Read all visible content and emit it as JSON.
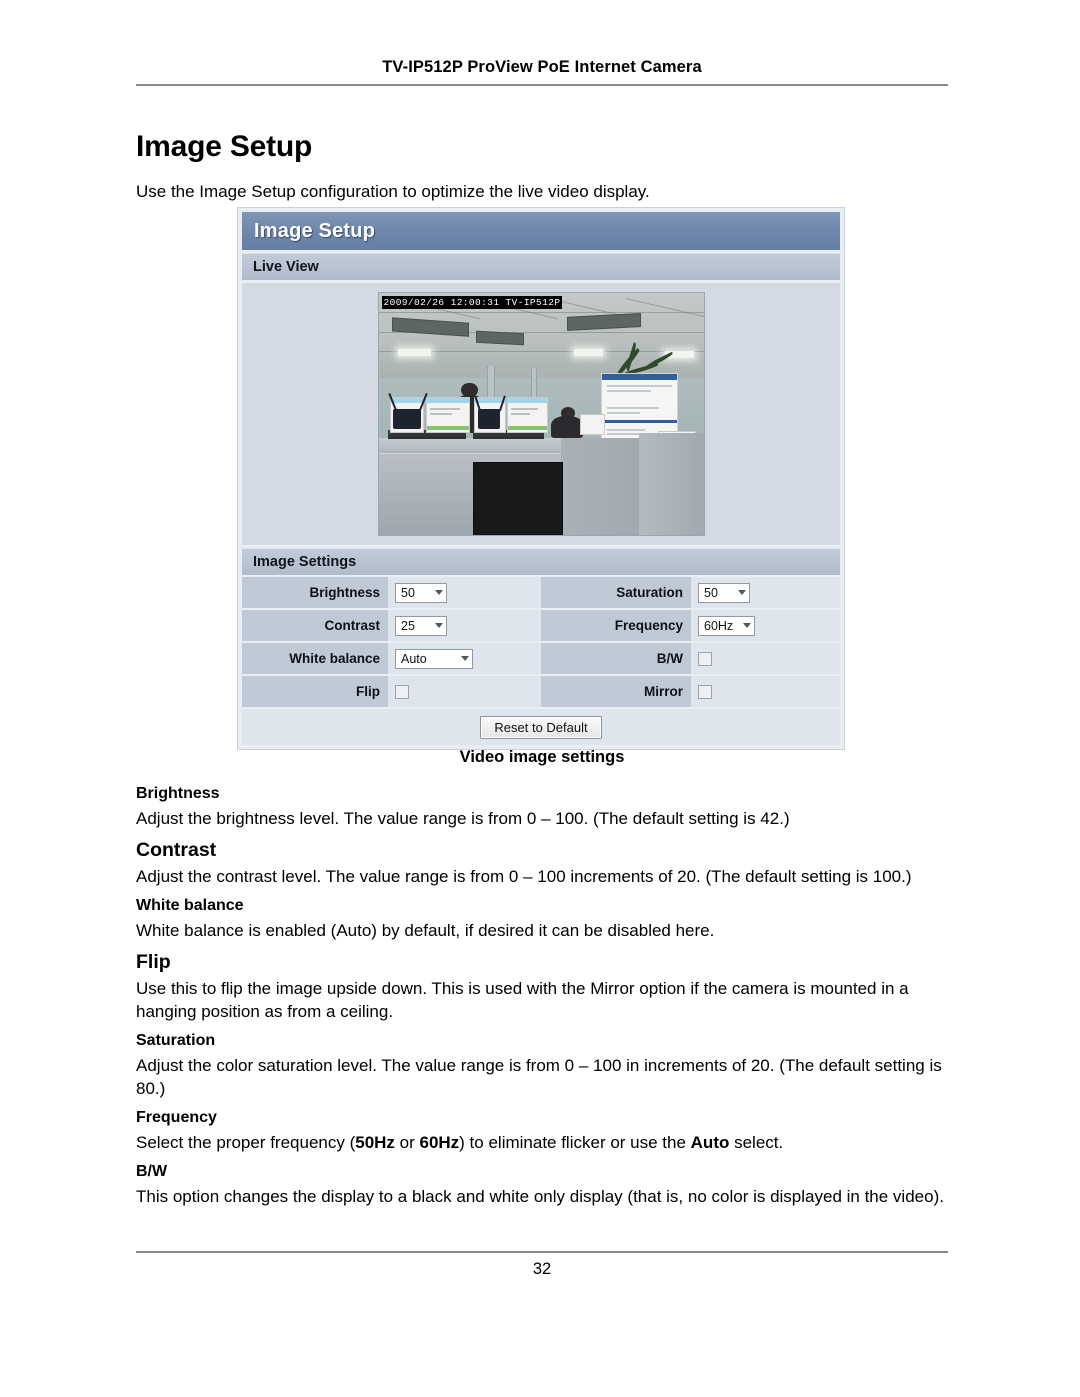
{
  "document": {
    "running_header": "TV-IP512P ProView PoE Internet Camera",
    "title": "Image Setup",
    "intro": "Use the Image Setup configuration to optimize the live video display.",
    "page_number": "32"
  },
  "ui_panel": {
    "titlebar": "Image Setup",
    "live_view_label": "Live View",
    "video": {
      "osd_text": "2009/02/26 12:00:31 TV-IP512P"
    },
    "image_settings_label": "Image Settings",
    "settings_left": [
      {
        "label": "Brightness",
        "control": "select",
        "value": "50"
      },
      {
        "label": "Contrast",
        "control": "select",
        "value": "25"
      },
      {
        "label": "White balance",
        "control": "select",
        "value": "Auto"
      },
      {
        "label": "Flip",
        "control": "checkbox",
        "value": "",
        "checked": false
      }
    ],
    "settings_right": [
      {
        "label": "Saturation",
        "control": "select",
        "value": "50"
      },
      {
        "label": "Frequency",
        "control": "select",
        "value": "60Hz"
      },
      {
        "label": "B/W",
        "control": "checkbox",
        "value": "",
        "checked": false
      },
      {
        "label": "Mirror",
        "control": "checkbox",
        "value": "",
        "checked": false
      }
    ],
    "reset_button": "Reset to Default",
    "colors": {
      "titlebar": "#6d86aa",
      "subbar": "#b0bbcb",
      "label_cell": "#c0c9d6",
      "value_cell": "#dfe5ed",
      "panel_bg": "#e9eef5"
    }
  },
  "body": {
    "caption": "Video image settings",
    "sections": [
      {
        "heading": "Brightness",
        "heading_size": "normal",
        "paragraphs": [
          {
            "parts": [
              {
                "text": "Adjust the brightness level. The value range is from 0 – 100. (The default setting is 42.)",
                "bold": false
              }
            ]
          }
        ]
      },
      {
        "heading": "Contrast",
        "heading_size": "big",
        "paragraphs": [
          {
            "parts": [
              {
                "text": "Adjust the contrast level. The value range is from 0 – 100 increments of 20. (The default setting is 100.)",
                "bold": false
              }
            ]
          }
        ]
      },
      {
        "heading": "White balance",
        "heading_size": "normal",
        "paragraphs": [
          {
            "parts": [
              {
                "text": "White balance is enabled (Auto) by default, if desired it can be disabled here.",
                "bold": false
              }
            ]
          }
        ]
      },
      {
        "heading": "Flip",
        "heading_size": "big",
        "paragraphs": [
          {
            "parts": [
              {
                "text": "Use this to flip the image upside down. This is used with the Mirror option if the camera is mounted in a hanging position as from a ceiling.",
                "bold": false
              }
            ]
          }
        ]
      },
      {
        "heading": "Saturation",
        "heading_size": "normal",
        "paragraphs": [
          {
            "parts": [
              {
                "text": "Adjust the color saturation level. The value range is from 0 – 100 in increments of 20. (The default setting is 80.)",
                "bold": false
              }
            ]
          }
        ]
      },
      {
        "heading": "Frequency",
        "heading_size": "normal",
        "paragraphs": [
          {
            "parts": [
              {
                "text": "Select the proper frequency (",
                "bold": false
              },
              {
                "text": "50Hz",
                "bold": true
              },
              {
                "text": " or ",
                "bold": false
              },
              {
                "text": "60Hz",
                "bold": true
              },
              {
                "text": ") to eliminate flicker or use the ",
                "bold": false
              },
              {
                "text": "Auto",
                "bold": true
              },
              {
                "text": " select.",
                "bold": false
              }
            ]
          }
        ]
      },
      {
        "heading": "B/W",
        "heading_size": "normal",
        "paragraphs": [
          {
            "parts": [
              {
                "text": "This option changes the display to a black and white only display (that is, no color is displayed in the video).",
                "bold": false
              }
            ]
          }
        ]
      }
    ]
  }
}
